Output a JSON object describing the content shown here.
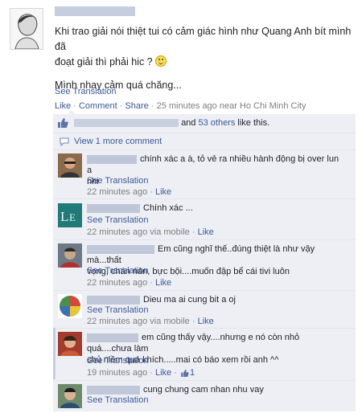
{
  "post": {
    "text_line1": "Khi trao giải nói thiệt tui có cảm giác hình như Quang Anh bít mình đã",
    "text_line2": "đoạt giải thì phải hic ?",
    "text_line3": "Mình nhay cảm quá chăng...",
    "see_translation": "See Translation",
    "actions": {
      "like": "Like",
      "sep": " · ",
      "comment": "Comment",
      "share": "Share",
      "time_location": "25 minutes ago near Ho Chi Minh City",
      "more": "·"
    }
  },
  "likes": {
    "and": "and",
    "others_link": "53 others",
    "suffix": "like this."
  },
  "view_more": "View 1 more comment",
  "comments": [
    {
      "text": "chính xác a à, tỏ vẻ ra nhiều hành động bị over lun a",
      "text2": "nhi",
      "see_translation": "See Translation",
      "time": "22 minutes ago",
      "like": "Like"
    },
    {
      "text": "Chính xác ...",
      "see_translation": "See Translation",
      "time": "22 minutes ago via mobile",
      "like": "Like"
    },
    {
      "text": "Em cũng nghĩ thế..đúng thiệt là như vậy mà...thất",
      "text2": "vọng, chán nản, bực bội....muốn đập bể cái tivi luôn",
      "see_translation": "See Translation",
      "time": "22 minutes ago",
      "like": "Like"
    },
    {
      "text": "Dieu ma ai cung bit a oj",
      "see_translation": "See Translation",
      "time": "22 minutes ago via mobile",
      "like": "Like"
    },
    {
      "text": "em cũng thấy vậy....nhưng e nó còn nhỏ quá....chưa làm",
      "text2": "chủ niềm quá khích.....mai có báo xem rồi anh ^^",
      "see_translation": "See Translation",
      "time": "19 minutes ago",
      "like": "Like",
      "like_count": "1"
    },
    {
      "text": "cung chung cam nhan nhu vay",
      "see_translation": "See Translation"
    }
  ],
  "colors": {
    "link": "#3b5998",
    "panel": "#edeff4",
    "meta": "#7f7f7f"
  },
  "icons": [
    "profile-avatar",
    "smiley-icon",
    "thumbs-up-icon",
    "comment-bubble-icon"
  ]
}
